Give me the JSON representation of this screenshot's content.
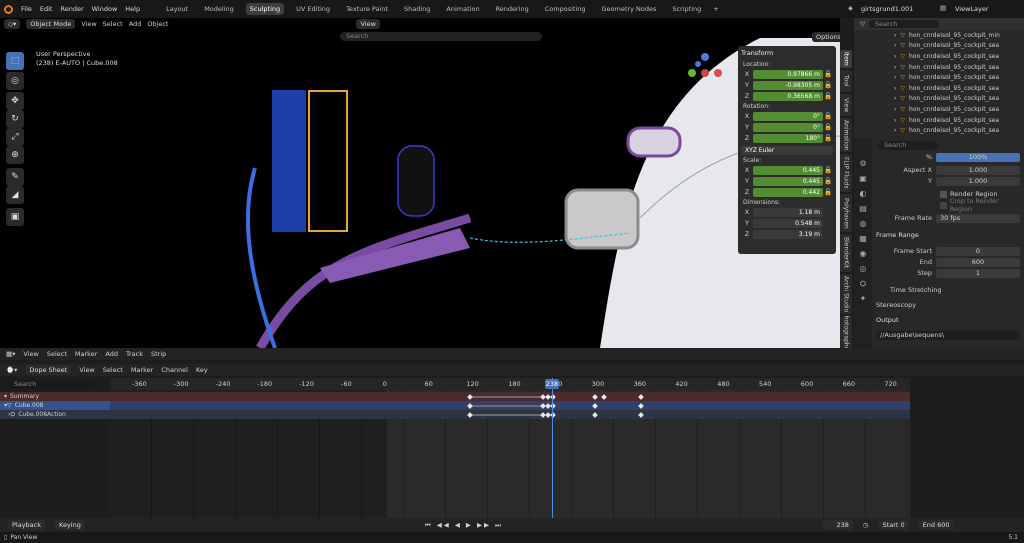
{
  "menu": [
    "File",
    "Edit",
    "Render",
    "Window",
    "Help"
  ],
  "workspaces": [
    "Layout",
    "Modeling",
    "Sculpting",
    "UV Editing",
    "Texture Paint",
    "Shading",
    "Animation",
    "Rendering",
    "Compositing",
    "Geometry Nodes",
    "Scripting"
  ],
  "active_workspace": "Sculpting",
  "plus": "+",
  "scene": "girtsgrund1.001",
  "viewlayer": "ViewLayer",
  "search_ph": "Search",
  "vp": {
    "mode": "Object Mode",
    "menus": [
      "View",
      "Select",
      "Add",
      "Object"
    ],
    "transform_orient": "View",
    "persp": "User Perspective",
    "info": "(238) E-AUTO | Cube.008",
    "options": "Options"
  },
  "tf": {
    "title": "Transform",
    "loc_l": "Location:",
    "loc": [
      "0.97866 m",
      "-0.98305 m",
      "0.36568 m"
    ],
    "rot_l": "Rotation:",
    "rot": [
      "0°",
      "0°",
      "180°"
    ],
    "mode": "XYZ Euler",
    "scale_l": "Scale:",
    "scale": [
      "0.445",
      "0.445",
      "0.442"
    ],
    "dim_l": "Dimensions:",
    "dim": [
      "1.18 m",
      "0.548 m",
      "3.19 m"
    ],
    "axes": [
      "X",
      "Y",
      "Z"
    ]
  },
  "ntabs": [
    "Item",
    "Tool",
    "View",
    "Animation",
    "FLIP Fluids",
    "Polyhaven",
    "BlenderKit",
    "Archi Studio",
    "Photographer"
  ],
  "outliner": [
    "hon_cnrdeisol_95_cockpit_min",
    "hon_cnrdeisol_95_cockpit_sea",
    "hon_cnrdeisol_95_cockpit_sea",
    "hon_cnrdeisol_95_cockpit_sea",
    "hon_cnrdeisol_95_cockpit_sea",
    "hon_cnrdeisol_95_cockpit_sea",
    "hon_cnrdeisol_95_cockpit_sea",
    "hon_cnrdeisol_95_cockpit_sea",
    "hon_cnrdeisol_95_cockpit_sea",
    "hon_cnrdeisol_95_cockpit_sea",
    "hon_cnrdeisol_95_cockpit_sea"
  ],
  "props": {
    "pct_l": "%",
    "pct": "100%",
    "aspx_l": "Aspect X",
    "aspx": "1.000",
    "y_l": "Y",
    "y": "1.000",
    "render_region": "Render Region",
    "crop": "Crop to Render Region",
    "fr_l": "Frame Rate",
    "fr": "30 fps",
    "frange": "Frame Range",
    "fs_l": "Frame Start",
    "fs": "0",
    "fe_l": "End",
    "fe": "600",
    "step_l": "Step",
    "step": "1",
    "time_stretch": "Time Stretching",
    "stereo": "Stereoscopy",
    "output": "Output",
    "path": "//Ausgabe\\sequens\\"
  },
  "ds": {
    "menus": [
      "View",
      "Select",
      "Marker",
      "Add",
      "Track",
      "Strip"
    ],
    "mode": "Dope Sheet",
    "menus2": [
      "View",
      "Select",
      "Marker",
      "Channel",
      "Key"
    ],
    "channels": [
      "Summary",
      "Cube.008",
      "Cube.008Action"
    ],
    "ticks": [
      "-360",
      "-300",
      "-240",
      "-180",
      "-120",
      "-60",
      "0",
      "60",
      "120",
      "180",
      "240",
      "300",
      "360",
      "420",
      "480",
      "540",
      "600",
      "660",
      "720"
    ],
    "current": "238"
  },
  "footer": {
    "playback": "Playback",
    "keying": "Keying",
    "frame": "238",
    "start_l": "Start",
    "start": "0",
    "end_l": "End",
    "end": "600"
  },
  "status": {
    "left": "Pan View",
    "right": "5.1"
  },
  "colors": {
    "accent": "#4772b3",
    "vec": "#548c34",
    "orange": "#e87d0d"
  }
}
